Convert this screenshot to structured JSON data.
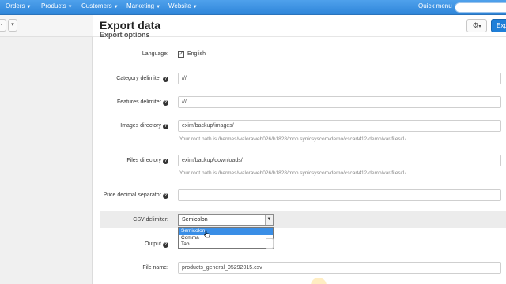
{
  "nav": {
    "items": [
      {
        "label": "Orders"
      },
      {
        "label": "Products"
      },
      {
        "label": "Customers"
      },
      {
        "label": "Marketing"
      },
      {
        "label": "Website"
      }
    ],
    "quick_menu": "Quick menu"
  },
  "page": {
    "title": "Export data",
    "section_title": "Export options",
    "export_button": "Exp"
  },
  "form": {
    "language": {
      "label": "Language:",
      "checked": true,
      "value": "English"
    },
    "category_delimiter": {
      "label": "Category delimiter",
      "value": "///"
    },
    "features_delimiter": {
      "label": "Features delimiter",
      "value": "///"
    },
    "images_directory": {
      "label": "Images directory",
      "value": "exim/backup/images/",
      "hint": "Your root path is /hermes/waloraweb026/b1828/moo.synicsyscom/demo/cscart412-demo/var/files/1/"
    },
    "files_directory": {
      "label": "Files directory",
      "value": "exim/backup/downloads/",
      "hint": "Your root path is /hermes/waloraweb026/b1828/moo.synicsyscom/demo/cscart412-demo/var/files/1/"
    },
    "price_decimal_separator": {
      "label": "Price decimal separator",
      "value": ""
    },
    "csv_delimiter": {
      "label": "CSV delimiter:",
      "selected": "Semicolon",
      "options": [
        "Semicolon",
        "Comma",
        "Tab"
      ]
    },
    "output": {
      "label": "Output"
    },
    "file_name": {
      "label": "File name:",
      "value": "products_general_05292015.csv"
    }
  }
}
